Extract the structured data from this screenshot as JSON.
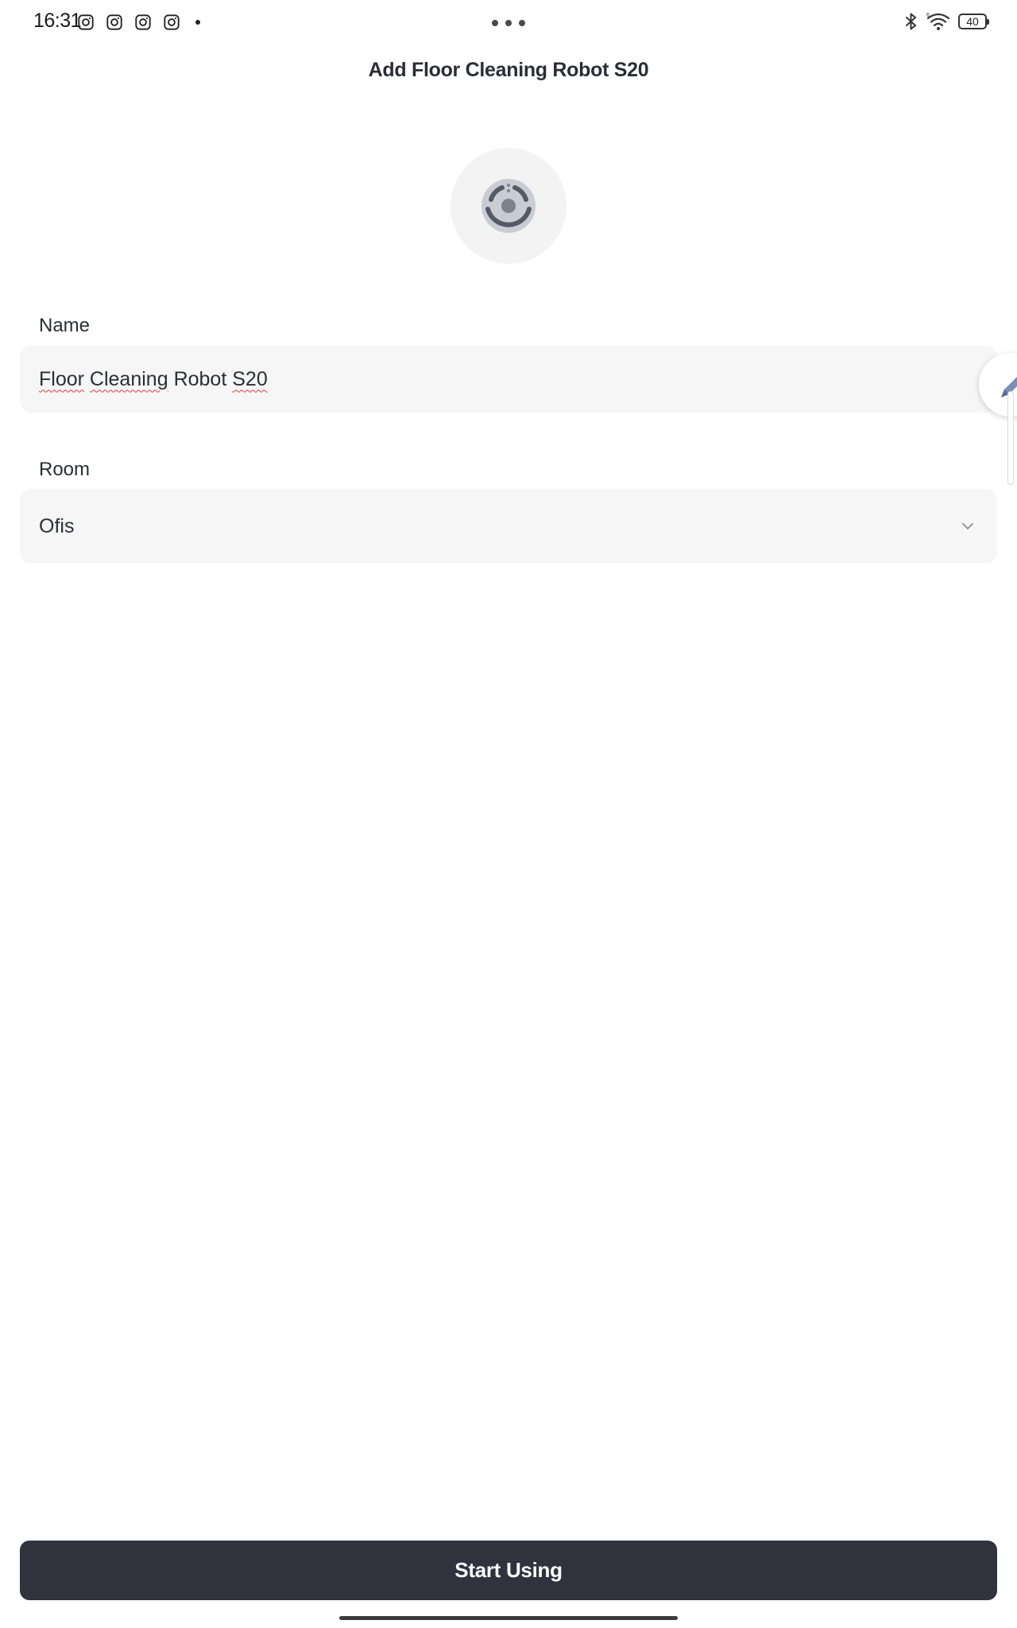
{
  "status_bar": {
    "time": "16:31",
    "notification_icons": [
      "instagram-icon",
      "instagram-icon",
      "instagram-icon",
      "instagram-icon"
    ],
    "battery_level": "40",
    "right_icons": [
      "bluetooth-icon",
      "wifi-icon",
      "battery-icon"
    ]
  },
  "header": {
    "title": "Add Floor Cleaning Robot S20"
  },
  "device": {
    "icon": "robot-vacuum-icon"
  },
  "form": {
    "name_label": "Name",
    "name_value": "Floor Cleaning Robot S20",
    "name_words": [
      "Floor",
      "Cleaning",
      "Robot",
      "S20"
    ],
    "room_label": "Room",
    "room_value": "Ofis"
  },
  "footer": {
    "start_button_label": "Start Using"
  },
  "colors": {
    "button_bg": "#30333e",
    "field_bg": "#f6f6f7",
    "text": "#2b2e36",
    "spellcheck_underline": "#e53935"
  }
}
